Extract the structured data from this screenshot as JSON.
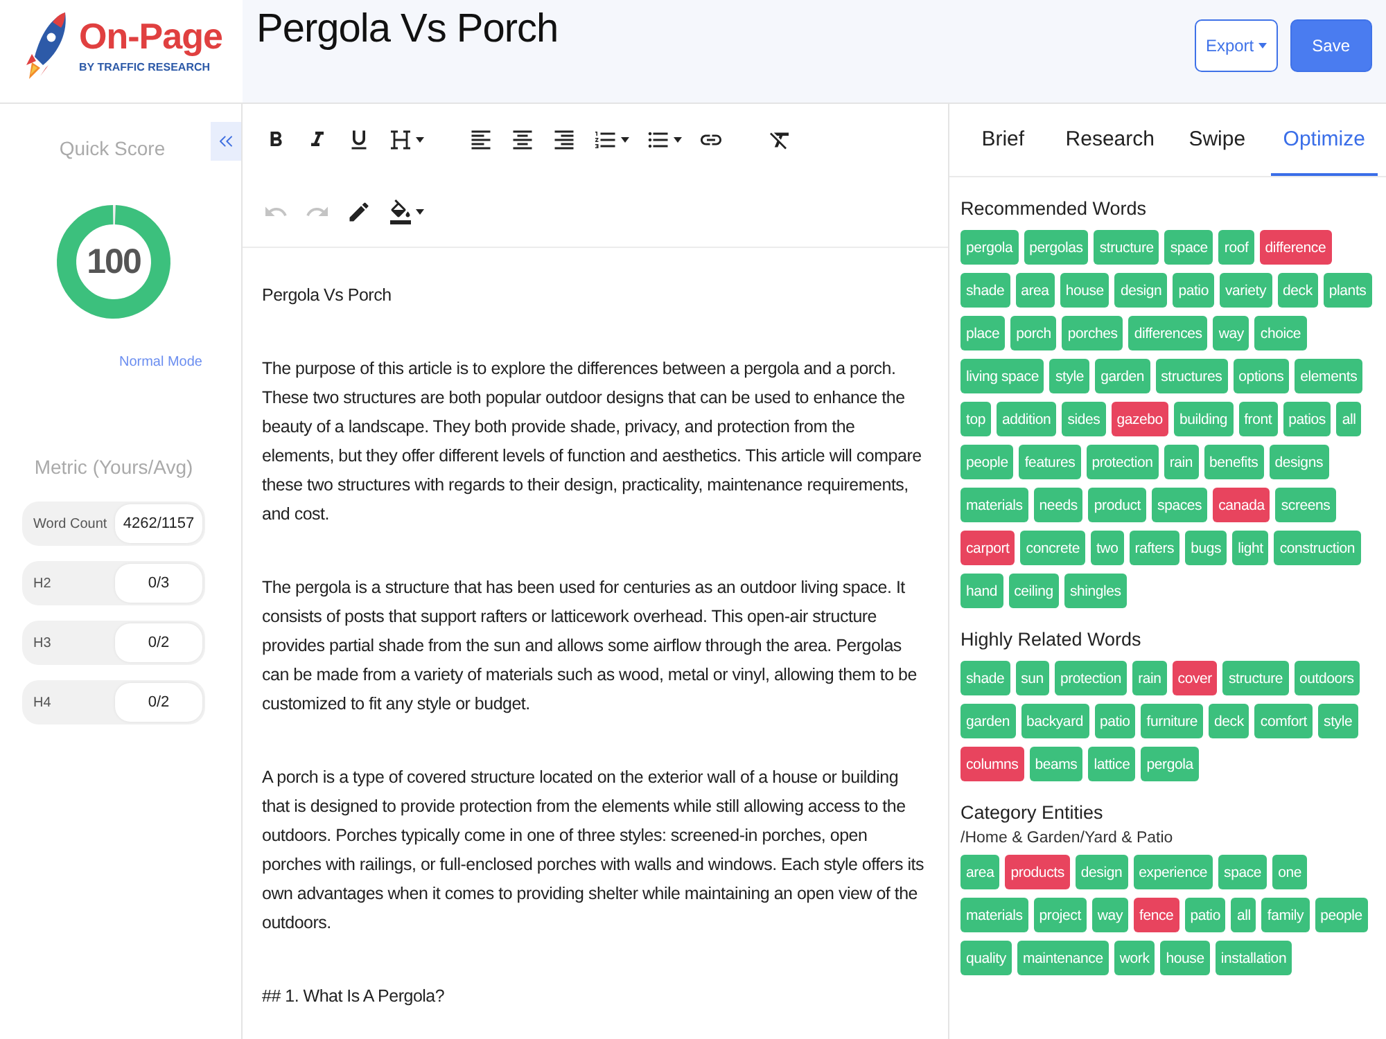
{
  "logo": {
    "name": "On-Page",
    "tagline": "BY TRAFFIC RESEARCH"
  },
  "document": {
    "title": "Pergola Vs Porch"
  },
  "actions": [
    {
      "label": "Export",
      "kind": "menu"
    },
    {
      "label": "Save",
      "kind": "primary"
    }
  ],
  "quick_score": {
    "title": "Quick Score",
    "score": "100",
    "level": 1,
    "mode": "Normal Mode"
  },
  "metrics": {
    "title": "Metric (Yours/Avg)",
    "rows": [
      {
        "label": "Word Count",
        "value": "4262/1157"
      },
      {
        "label": "H2",
        "value": "0/3"
      },
      {
        "label": "H3",
        "value": "0/2"
      },
      {
        "label": "H4",
        "value": "0/2"
      }
    ]
  },
  "toolbar": {
    "rows": [
      {
        "groups": [
          {
            "items": [
              {
                "kind": "bold",
                "disabled": false
              },
              {
                "kind": "italic",
                "disabled": false
              },
              {
                "kind": "underline",
                "disabled": false
              },
              {
                "kind": "heading",
                "disabled": false
              }
            ]
          },
          {
            "items": [
              {
                "kind": "left",
                "disabled": false
              },
              {
                "kind": "center",
                "disabled": false
              },
              {
                "kind": "right",
                "disabled": false
              },
              {
                "kind": "numbered",
                "disabled": false
              },
              {
                "kind": "bulleted",
                "disabled": false
              },
              {
                "kind": "link",
                "disabled": false
              }
            ]
          },
          {
            "items": [
              {
                "kind": "clear",
                "disabled": false
              }
            ]
          }
        ]
      },
      {
        "groups": [
          {
            "items": [
              {
                "kind": "undo",
                "disabled": true
              },
              {
                "kind": "redo",
                "disabled": true
              },
              {
                "kind": "pen",
                "disabled": false
              },
              {
                "kind": "fill",
                "disabled": false
              }
            ]
          }
        ]
      }
    ]
  },
  "editor": {
    "title": "Pergola Vs Porch",
    "paragraphs": [
      "The purpose of this article is to explore the differences between a pergola and a porch. These two structures are both popular outdoor designs that can be used to enhance the beauty of a landscape. They both provide shade, privacy, and protection from the elements, but they offer different levels of function and aesthetics. This article will compare these two structures with regards to their design, practicality, maintenance requirements, and cost.",
      "The pergola is a structure that has been used for centuries as an outdoor living space. It consists of posts that support rafters or latticework overhead. This open-air structure provides partial shade from the sun and allows some airflow through the area. Pergolas can be made from a variety of materials such as wood, metal or vinyl, allowing them to be customized to fit any style or budget.",
      "A porch is a type of covered structure located on the exterior wall of a house or building that is designed to provide protection from the elements while still allowing access to the outdoors. Porches typically come in one of three styles: screened-in porches, open porches with railings, or full-enclosed porches with walls and windows. Each style offers its own advantages when it comes to providing shelter while maintaining an open view of the outdoors.",
      "## 1. What Is A Pergola?"
    ]
  },
  "tabs": [
    {
      "label": "Brief",
      "selected": false
    },
    {
      "label": "Research",
      "selected": false
    },
    {
      "label": "Swipe",
      "selected": false
    },
    {
      "label": "Optimize",
      "selected": true
    }
  ],
  "sections": [
    {
      "title": "Recommended Words",
      "words": [
        {
          "text": "pergola",
          "color": "#3cc07d"
        },
        {
          "text": "pergolas",
          "color": "#3cc07d"
        },
        {
          "text": "structure",
          "color": "#3cc07d"
        },
        {
          "text": "space",
          "color": "#3cc07d"
        },
        {
          "text": "roof",
          "color": "#3cc07d"
        },
        {
          "text": "difference",
          "color": "#e8445e"
        },
        {
          "text": "shade",
          "color": "#3cc07d"
        },
        {
          "text": "area",
          "color": "#3cc07d"
        },
        {
          "text": "house",
          "color": "#3cc07d"
        },
        {
          "text": "design",
          "color": "#3cc07d"
        },
        {
          "text": "patio",
          "color": "#3cc07d"
        },
        {
          "text": "variety",
          "color": "#3cc07d"
        },
        {
          "text": "deck",
          "color": "#3cc07d"
        },
        {
          "text": "plants",
          "color": "#3cc07d"
        },
        {
          "text": "place",
          "color": "#3cc07d"
        },
        {
          "text": "porch",
          "color": "#3cc07d"
        },
        {
          "text": "porches",
          "color": "#3cc07d"
        },
        {
          "text": "differences",
          "color": "#3cc07d"
        },
        {
          "text": "way",
          "color": "#3cc07d"
        },
        {
          "text": "choice",
          "color": "#3cc07d"
        },
        {
          "text": "living space",
          "color": "#3cc07d"
        },
        {
          "text": "style",
          "color": "#3cc07d"
        },
        {
          "text": "garden",
          "color": "#3cc07d"
        },
        {
          "text": "structures",
          "color": "#3cc07d"
        },
        {
          "text": "options",
          "color": "#3cc07d"
        },
        {
          "text": "elements",
          "color": "#3cc07d"
        },
        {
          "text": "top",
          "color": "#3cc07d"
        },
        {
          "text": "addition",
          "color": "#3cc07d"
        },
        {
          "text": "sides",
          "color": "#3cc07d"
        },
        {
          "text": "gazebo",
          "color": "#e8445e"
        },
        {
          "text": "building",
          "color": "#3cc07d"
        },
        {
          "text": "front",
          "color": "#3cc07d"
        },
        {
          "text": "patios",
          "color": "#3cc07d"
        },
        {
          "text": "all",
          "color": "#3cc07d"
        },
        {
          "text": "people",
          "color": "#3cc07d"
        },
        {
          "text": "features",
          "color": "#3cc07d"
        },
        {
          "text": "protection",
          "color": "#3cc07d"
        },
        {
          "text": "rain",
          "color": "#3cc07d"
        },
        {
          "text": "benefits",
          "color": "#3cc07d"
        },
        {
          "text": "designs",
          "color": "#3cc07d"
        },
        {
          "text": "materials",
          "color": "#3cc07d"
        },
        {
          "text": "needs",
          "color": "#3cc07d"
        },
        {
          "text": "product",
          "color": "#3cc07d"
        },
        {
          "text": "spaces",
          "color": "#3cc07d"
        },
        {
          "text": "canada",
          "color": "#e8445e"
        },
        {
          "text": "screens",
          "color": "#3cc07d"
        },
        {
          "text": "carport",
          "color": "#e8445e"
        },
        {
          "text": "concrete",
          "color": "#3cc07d"
        },
        {
          "text": "two",
          "color": "#3cc07d"
        },
        {
          "text": "rafters",
          "color": "#3cc07d"
        },
        {
          "text": "bugs",
          "color": "#3cc07d"
        },
        {
          "text": "light",
          "color": "#3cc07d"
        },
        {
          "text": "construction",
          "color": "#3cc07d"
        },
        {
          "text": "hand",
          "color": "#3cc07d"
        },
        {
          "text": "ceiling",
          "color": "#3cc07d"
        },
        {
          "text": "shingles",
          "color": "#3cc07d"
        }
      ]
    },
    {
      "title": "Highly Related Words",
      "words": [
        {
          "text": "shade",
          "color": "#3cc07d"
        },
        {
          "text": "sun",
          "color": "#3cc07d"
        },
        {
          "text": "protection",
          "color": "#3cc07d"
        },
        {
          "text": "rain",
          "color": "#3cc07d"
        },
        {
          "text": "cover",
          "color": "#e8445e"
        },
        {
          "text": "structure",
          "color": "#3cc07d"
        },
        {
          "text": "outdoors",
          "color": "#3cc07d"
        },
        {
          "text": "garden",
          "color": "#3cc07d"
        },
        {
          "text": "backyard",
          "color": "#3cc07d"
        },
        {
          "text": "patio",
          "color": "#3cc07d"
        },
        {
          "text": "furniture",
          "color": "#3cc07d"
        },
        {
          "text": "deck",
          "color": "#3cc07d"
        },
        {
          "text": "comfort",
          "color": "#3cc07d"
        },
        {
          "text": "style",
          "color": "#3cc07d"
        },
        {
          "text": "columns",
          "color": "#e8445e"
        },
        {
          "text": "beams",
          "color": "#3cc07d"
        },
        {
          "text": "lattice",
          "color": "#3cc07d"
        },
        {
          "text": "pergola",
          "color": "#3cc07d"
        }
      ]
    },
    {
      "title": "Category Entities",
      "subtitle": "/Home & Garden/Yard & Patio",
      "words": [
        {
          "text": "area",
          "color": "#3cc07d"
        },
        {
          "text": "products",
          "color": "#e8445e"
        },
        {
          "text": "design",
          "color": "#3cc07d"
        },
        {
          "text": "experience",
          "color": "#3cc07d"
        },
        {
          "text": "space",
          "color": "#3cc07d"
        },
        {
          "text": "one",
          "color": "#3cc07d"
        },
        {
          "text": "materials",
          "color": "#3cc07d"
        },
        {
          "text": "project",
          "color": "#3cc07d"
        },
        {
          "text": "way",
          "color": "#3cc07d"
        },
        {
          "text": "fence",
          "color": "#e8445e"
        },
        {
          "text": "patio",
          "color": "#3cc07d"
        },
        {
          "text": "all",
          "color": "#3cc07d"
        },
        {
          "text": "family",
          "color": "#3cc07d"
        },
        {
          "text": "people",
          "color": "#3cc07d"
        },
        {
          "text": "quality",
          "color": "#3cc07d"
        },
        {
          "text": "maintenance",
          "color": "#3cc07d"
        },
        {
          "text": "work",
          "color": "#3cc07d"
        },
        {
          "text": "house",
          "color": "#3cc07d"
        },
        {
          "text": "installation",
          "color": "#3cc07d"
        }
      ]
    }
  ]
}
